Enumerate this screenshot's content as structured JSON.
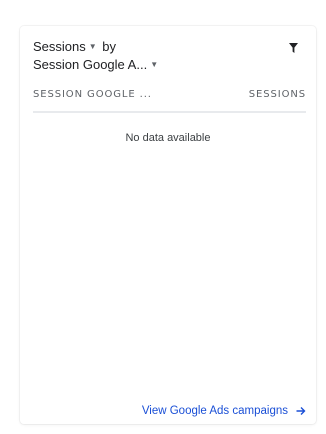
{
  "card": {
    "metric_label": "Sessions",
    "by_label": "by",
    "dimension_label": "Session Google A...",
    "table": {
      "columns": [
        "SESSION GOOGLE ...",
        "SESSIONS"
      ]
    },
    "empty_message": "No data available",
    "footer_link_label": "View Google Ads campaigns"
  },
  "icons": {
    "filter": "filter-icon",
    "metric_caret": "caret-down-icon",
    "dimension_caret": "caret-down-icon",
    "footer_arrow": "arrow-right-icon"
  },
  "colors": {
    "link": "#1a4fd6",
    "text": "#202124",
    "muted": "#5f6368"
  }
}
